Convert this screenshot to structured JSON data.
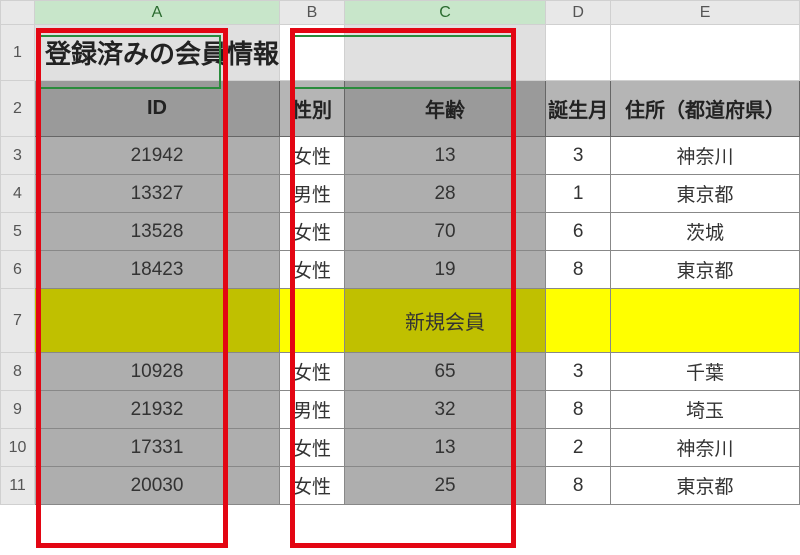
{
  "columns": [
    "A",
    "B",
    "C",
    "D",
    "E"
  ],
  "selected_columns": [
    "A",
    "C"
  ],
  "title": "登録済みの会員情報",
  "headers": {
    "A": "ID",
    "B": "性別",
    "C": "年齢",
    "D": "誕生月",
    "E": "住所（都道府県）"
  },
  "rows": [
    {
      "n": 3,
      "A": "21942",
      "B": "女性",
      "C": "13",
      "D": "3",
      "E": "神奈川"
    },
    {
      "n": 4,
      "A": "13327",
      "B": "男性",
      "C": "28",
      "D": "1",
      "E": "東京都"
    },
    {
      "n": 5,
      "A": "13528",
      "B": "女性",
      "C": "70",
      "D": "6",
      "E": "茨城"
    },
    {
      "n": 6,
      "A": "18423",
      "B": "女性",
      "C": "19",
      "D": "8",
      "E": "東京都"
    }
  ],
  "new_member_row": {
    "n": 7,
    "label": "新規会員"
  },
  "rows2": [
    {
      "n": 8,
      "A": "10928",
      "B": "女性",
      "C": "65",
      "D": "3",
      "E": "千葉"
    },
    {
      "n": 9,
      "A": "21932",
      "B": "男性",
      "C": "32",
      "D": "8",
      "E": "埼玉"
    },
    {
      "n": 10,
      "A": "17331",
      "B": "女性",
      "C": "13",
      "D": "2",
      "E": "神奈川"
    },
    {
      "n": 11,
      "A": "20030",
      "B": "女性",
      "C": "25",
      "D": "8",
      "E": "東京都"
    }
  ]
}
